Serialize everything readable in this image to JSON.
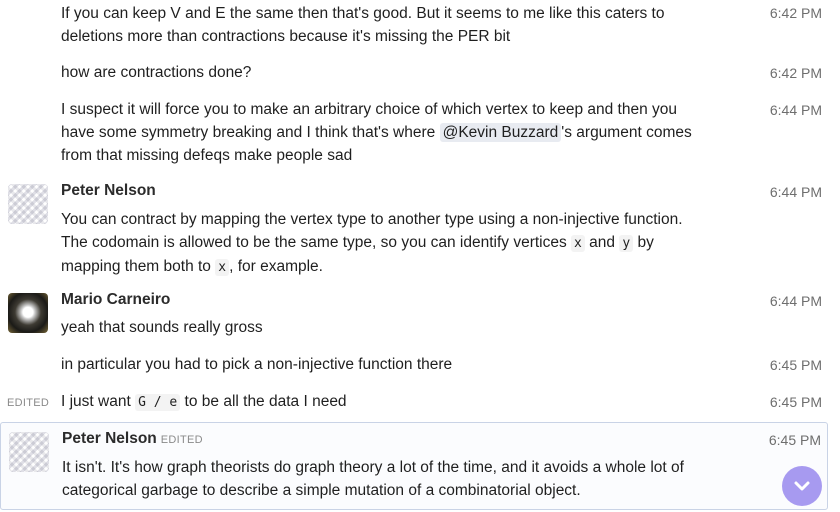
{
  "messages": [
    {
      "time": "6:42 PM",
      "lines": [
        "If you can keep V and E the same then that's good. But it seems to me like this caters to",
        "deletions more than contractions because it's missing the PER bit"
      ]
    },
    {
      "time": "6:42 PM",
      "text": "how are contractions done?"
    },
    {
      "time": "6:44 PM",
      "line1": "I suspect it will force you to make an arbitrary choice of which vertex to keep and then you",
      "line2_pre": "have some symmetry breaking and I think that's where ",
      "mention": "@Kevin Buzzard",
      "line2_post": "'s argument comes",
      "line3": "from that missing defeqs make people sad"
    },
    {
      "sender": "Peter Nelson",
      "time": "6:44 PM",
      "line1": "You can contract by mapping the vertex type to another type using a non-injective function.",
      "line2_pre": "The codomain is allowed to be the same type, so you can identify vertices ",
      "code1": "x",
      "line2_mid": " and ",
      "code2": "y",
      "line2_post": " by",
      "line3_pre": "mapping them both to ",
      "code3": "x",
      "line3_post": ", for example."
    },
    {
      "sender": "Mario Carneiro",
      "time": "6:44 PM",
      "text": "yeah that sounds really gross"
    },
    {
      "time": "6:45 PM",
      "text": "in particular you had to pick a non-injective function there"
    },
    {
      "time": "6:45 PM",
      "edited": "EDITED",
      "pre": "I just want ",
      "code": "G / e",
      "post": " to be all the data I need"
    },
    {
      "sender": "Peter Nelson",
      "edited": "EDITED",
      "time": "6:45 PM",
      "lines": [
        "It isn't. It's how graph theorists do graph theory a lot of the time, and it avoids a whole lot of",
        "categorical garbage to describe a simple mutation of a combinatorial object."
      ]
    }
  ],
  "scroll_button": {
    "icon": "chevron-down-icon",
    "color": "#a79af0"
  }
}
